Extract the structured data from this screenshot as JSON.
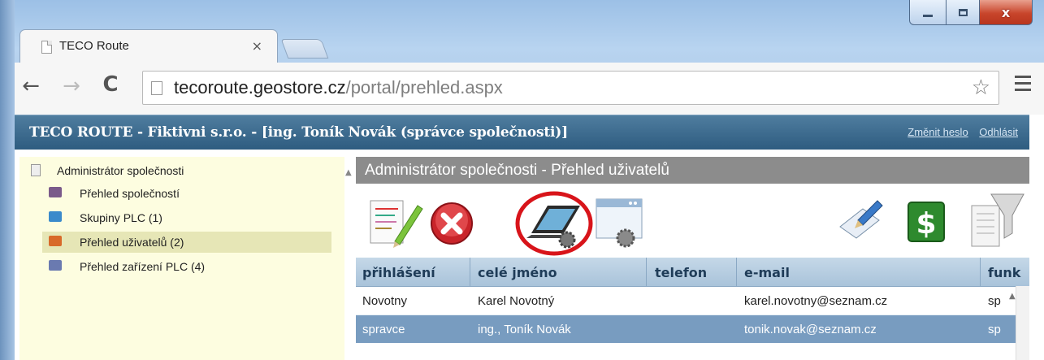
{
  "browser": {
    "tab_title": "TECO Route",
    "tab_close": "×",
    "url_host": "tecoroute.geostore.cz",
    "url_path": "/portal/prehled.aspx",
    "nav_back": "←",
    "nav_forward": "→",
    "nav_reload": "C",
    "star": "☆",
    "window_close": "x"
  },
  "app": {
    "title": "TECO ROUTE - Fiktivni s.r.o. - [ing. Toník Novák (správce společnosti)]",
    "change_password": "Změnit heslo",
    "logout": "Odhlásit"
  },
  "sidebar": {
    "root": "Administrátor společnosti",
    "items": [
      {
        "label": "Přehled společností",
        "icon": "books-icon",
        "color": "#7a5a8a"
      },
      {
        "label": "Skupiny PLC (1)",
        "icon": "network-icon",
        "color": "#3a8acb"
      },
      {
        "label": "Přehled uživatelů (2)",
        "icon": "users-icon",
        "color": "#d86a2a"
      },
      {
        "label": "Přehled zařízení PLC (4)",
        "icon": "plc-icon",
        "color": "#6a7ab0"
      }
    ],
    "selected_index": 2
  },
  "main": {
    "title": "Administrátor společnosti - Přehled uživatelů",
    "toolbar": [
      {
        "name": "edit-icon"
      },
      {
        "name": "delete-icon"
      },
      {
        "name": "laptop-settings-icon",
        "highlighted": true
      },
      {
        "name": "window-settings-icon"
      },
      {
        "name": "pen-icon"
      },
      {
        "name": "dollar-icon"
      },
      {
        "name": "filter-icon"
      }
    ],
    "columns": [
      "přihlášení",
      "celé jméno",
      "telefon",
      "e-mail",
      "funk"
    ],
    "rows": [
      {
        "login": "Novotny",
        "name": "Karel Novotný",
        "phone": "",
        "email": "karel.novotny@seznam.cz",
        "func": "sp"
      },
      {
        "login": "spravce",
        "name": "ing., Toník Novák",
        "phone": "",
        "email": "tonik.novak@seznam.cz",
        "func": "sp"
      }
    ],
    "selected_row": 1
  },
  "colors": {
    "appbar": "#2e5c80",
    "sidebar_bg": "#fdfde0",
    "selected_row": "#789cc0",
    "highlight_ring": "#d8141a"
  }
}
